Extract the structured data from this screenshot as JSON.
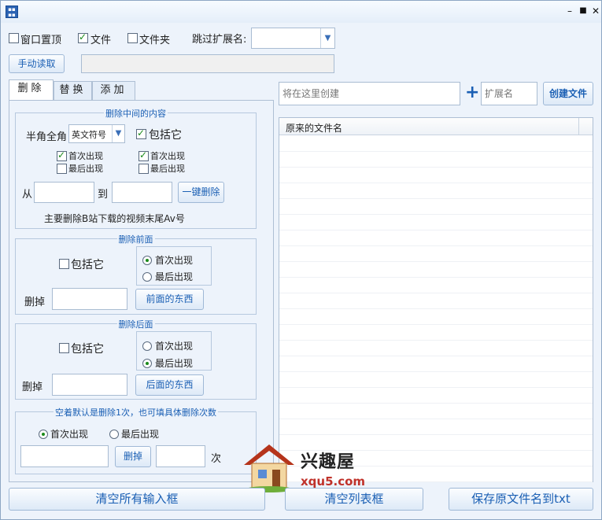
{
  "toolbar": {
    "topmost_label": "窗口置顶",
    "topmost_checked": false,
    "file_label": "文件",
    "file_checked": true,
    "folder_label": "文件夹",
    "folder_checked": false,
    "skip_ext_label": "跳过扩展名:",
    "skip_ext_value": "",
    "manual_read_button": "手动读取",
    "path_value": ""
  },
  "tabs": [
    {
      "label": "删除",
      "active": true
    },
    {
      "label": "替换",
      "active": false
    },
    {
      "label": "添加",
      "active": false
    }
  ],
  "delete_middle": {
    "title": "删除中间的内容",
    "width_label": "半角全角",
    "width_value": "英文符号",
    "include_label": "包括它",
    "include_checked": true,
    "left_first_label": "首次出现",
    "left_first_checked": true,
    "left_last_label": "最后出现",
    "left_last_checked": false,
    "right_first_label": "首次出现",
    "right_first_checked": true,
    "right_last_label": "最后出现",
    "right_last_checked": false,
    "from_label": "从",
    "from_value": "",
    "to_label": "到",
    "to_value": "",
    "delete_button": "一键删除",
    "note": "主要删除B站下载的视频末尾Av号"
  },
  "delete_front": {
    "title": "删除前面",
    "include_label": "包括它",
    "include_checked": false,
    "first_label": "首次出现",
    "first_selected": true,
    "last_label": "最后出现",
    "last_selected": false,
    "delete_label": "删掉",
    "delete_value": "",
    "button": "前面的东西"
  },
  "delete_back": {
    "title": "删除后面",
    "include_label": "包括它",
    "include_checked": false,
    "first_label": "首次出现",
    "first_selected": false,
    "last_label": "最后出现",
    "last_selected": true,
    "delete_label": "删掉",
    "delete_value": "",
    "button": "后面的东西"
  },
  "delete_count": {
    "title": "空着默认是删除1次，也可填具体删除次数",
    "first_label": "首次出现",
    "first_selected": true,
    "last_label": "最后出现",
    "last_selected": false,
    "text_value": "",
    "delete_button": "删掉",
    "count_value": "",
    "count_unit": "次"
  },
  "create": {
    "name_placeholder": "将在这里创建",
    "plus": "+",
    "ext_placeholder": "扩展名",
    "create_button": "创建文件"
  },
  "list": {
    "column": "原来的文件名",
    "rows": []
  },
  "bottom": {
    "clear_inputs": "清空所有输入框",
    "clear_list": "清空列表框",
    "save_txt": "保存原文件名到txt"
  },
  "watermark": {
    "name": "兴趣屋",
    "url": "xqu5.com"
  },
  "colors": {
    "accent": "#1a5fb4",
    "window_bg": "#edf3fb",
    "check_green": "#1a8a1a"
  }
}
